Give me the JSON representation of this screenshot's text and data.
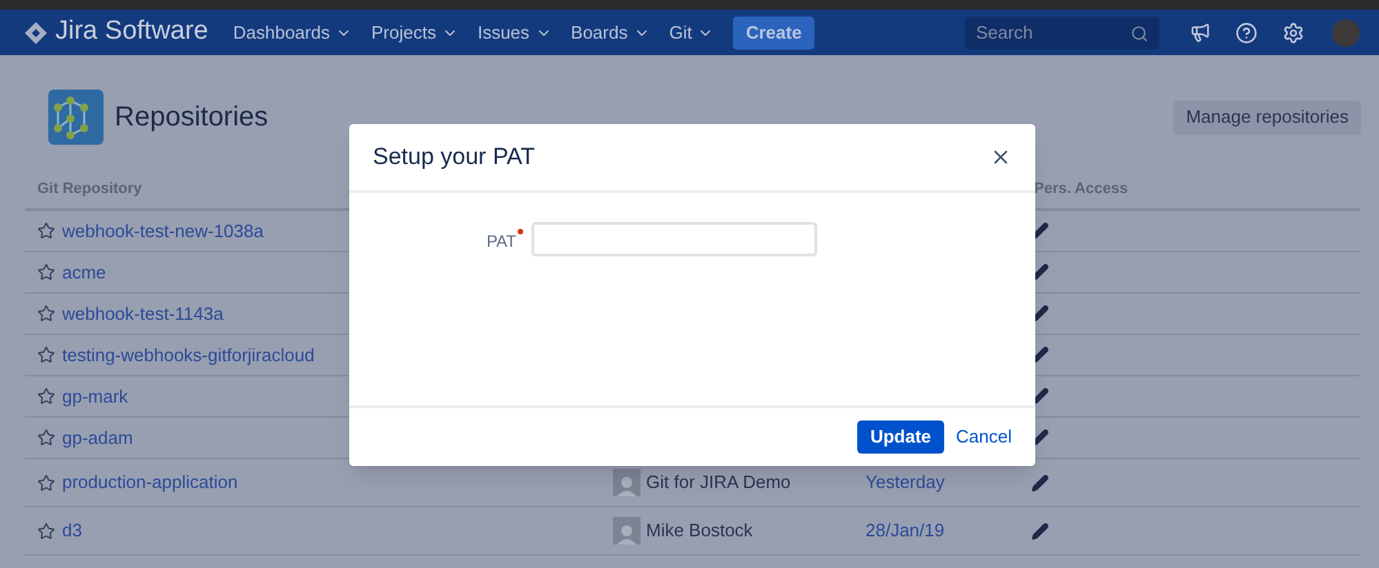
{
  "nav": {
    "product": "Jira Software",
    "menus": [
      "Dashboards",
      "Projects",
      "Issues",
      "Boards",
      "Git"
    ],
    "create": "Create",
    "search": {
      "placeholder": "Search"
    }
  },
  "page": {
    "title": "Repositories",
    "action": "Manage repositories"
  },
  "table": {
    "columns": [
      "Git Repository",
      "Pers. Access"
    ],
    "rows": [
      {
        "name": "webhook-test-new-1038a"
      },
      {
        "name": "acme"
      },
      {
        "name": "webhook-test-1143a"
      },
      {
        "name": "testing-webhooks-gitforjiracloud"
      },
      {
        "name": "gp-mark"
      },
      {
        "name": "gp-adam"
      },
      {
        "name": "production-application",
        "owner": "Git for JIRA Demo",
        "updated": "Yesterday"
      },
      {
        "name": "d3",
        "owner": "Mike Bostock",
        "updated": "28/Jan/19"
      }
    ]
  },
  "dialog": {
    "title": "Setup your PAT",
    "field": {
      "label": "PAT",
      "required": true
    },
    "buttons": [
      {
        "label": "Update",
        "kind": "primary"
      },
      {
        "label": "Cancel",
        "kind": "link"
      }
    ]
  }
}
